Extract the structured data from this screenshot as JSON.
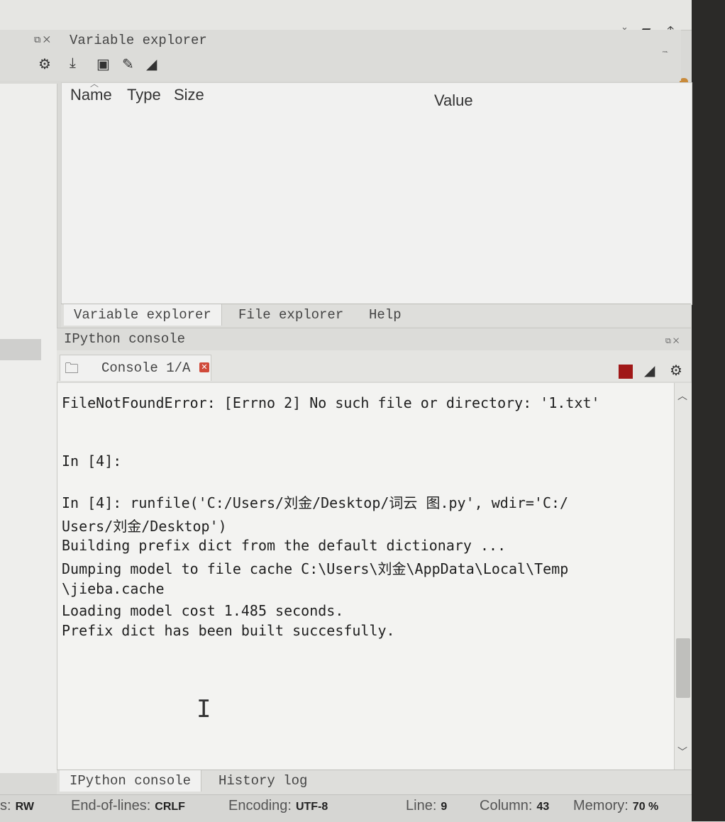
{
  "variable_explorer": {
    "title": "Variable explorer",
    "columns": [
      "Name",
      "Type",
      "Size",
      "Value"
    ]
  },
  "bottom_tabs_top": [
    "Variable explorer",
    "File explorer",
    "Help"
  ],
  "ipython": {
    "title": "IPython console",
    "console_tab": "Console 1/A",
    "lines": [
      {
        "text": "FileNotFoundError: [Errno 2] No such file or directory: '1.txt'"
      },
      {
        "text": "In [4]:"
      },
      {
        "text": "In [4]: runfile('C:/Users/刘金/Desktop/词云 图.py', wdir='C:/"
      },
      {
        "text": "Users/刘金/Desktop')"
      },
      {
        "text": "Building prefix dict from the default dictionary ..."
      },
      {
        "text": "Dumping model to file cache C:\\Users\\刘金\\AppData\\Local\\Temp"
      },
      {
        "text": "\\jieba.cache"
      },
      {
        "text": "Loading model cost 1.485 seconds."
      },
      {
        "text": "Prefix dict has been built succesfully."
      }
    ]
  },
  "bottom_tabs": [
    "IPython console",
    "History log"
  ],
  "status": {
    "permissions_label": "s:",
    "permissions": "RW",
    "eol_label": "End-of-lines:",
    "eol": "CRLF",
    "encoding_label": "Encoding:",
    "encoding": "UTF-8",
    "line_label": "Line:",
    "line": "9",
    "column_label": "Column:",
    "column": "43",
    "memory_label": "Memory:",
    "memory": "70 %"
  },
  "colors": {
    "error": "#b02a2a",
    "string": "#2f8a2f",
    "stop": "#a01818"
  },
  "icons": [
    "gear-icon",
    "import-icon",
    "save-icon",
    "save-as-icon",
    "eraser-icon",
    "folder-icon",
    "close-tab-icon",
    "stop-icon",
    "settings-icon",
    "undock-icon",
    "close-icon",
    "open-folder-icon",
    "up-arrow-icon"
  ]
}
